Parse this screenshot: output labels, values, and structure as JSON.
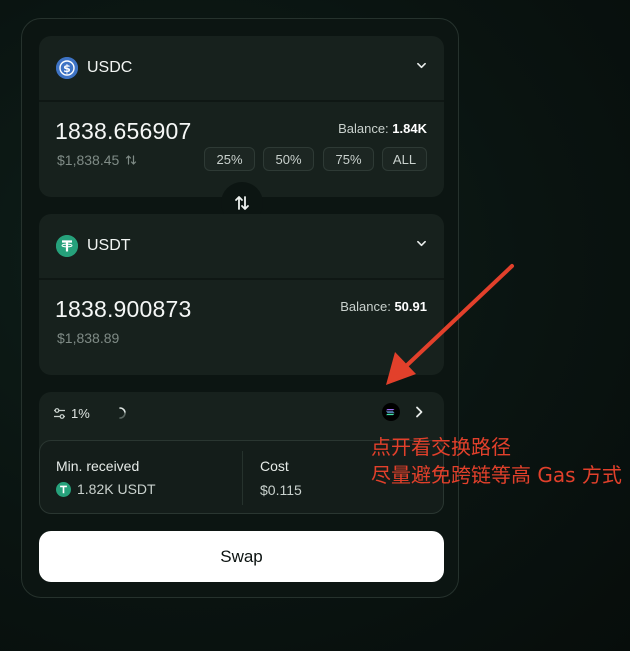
{
  "from_token": {
    "symbol": "USDC",
    "amount": "1838.656907",
    "usd_value": "$1,838.45",
    "balance_label": "Balance:",
    "balance_value": "1.84K",
    "percent_buttons": [
      "25%",
      "50%",
      "75%",
      "ALL"
    ]
  },
  "to_token": {
    "symbol": "USDT",
    "amount": "1838.900873",
    "usd_value": "$1,838.89",
    "balance_label": "Balance:",
    "balance_value": "50.91"
  },
  "route": {
    "slippage": "1%",
    "min_received_label": "Min. received",
    "min_received_value": "1.82K USDT",
    "cost_label": "Cost",
    "cost_value": "$0.115"
  },
  "swap_button_label": "Swap",
  "annotation": {
    "line1": "点开看交换路径",
    "line2": "尽量避免跨链等高 Gas 方式",
    "color": "#e2402b"
  },
  "colors": {
    "usdc": "#3e73c4",
    "usdt": "#26a17b",
    "background": "#0a1411",
    "panel": "#17211d"
  },
  "icons": [
    "usdc-icon",
    "usdt-icon",
    "chevron-down-icon",
    "swap-direction-icon",
    "settings-sliders-icon",
    "loading-spinner-icon",
    "solana-icon",
    "chevron-right-icon",
    "refresh-icon"
  ]
}
